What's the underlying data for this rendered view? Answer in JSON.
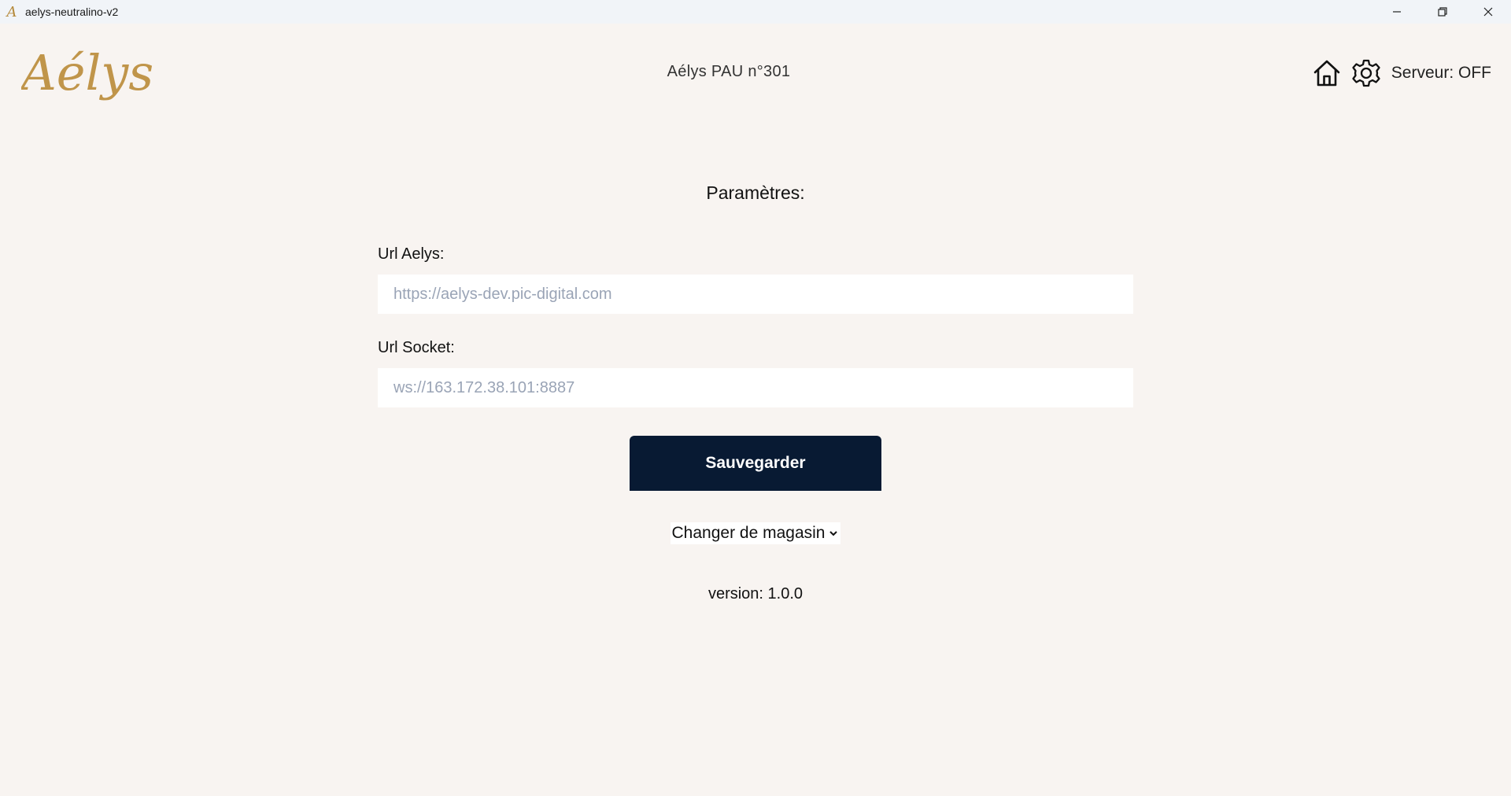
{
  "window": {
    "title": "aelys-neutralino-v2",
    "app_icon_glyph": "A",
    "controls": [
      "minimize-icon",
      "restore-icon",
      "close-icon"
    ]
  },
  "header": {
    "logo_text": "Aélys",
    "store_title": "Aélys PAU n°301",
    "icons": [
      "home-icon",
      "gear-icon"
    ],
    "server_status": "Serveur: OFF"
  },
  "settings": {
    "title": "Paramètres:",
    "url_aelys": {
      "label": "Url Aelys:",
      "placeholder": "https://aelys-dev.pic-digital.com",
      "value": ""
    },
    "url_socket": {
      "label": "Url Socket:",
      "placeholder": "ws://163.172.38.101:8887",
      "value": ""
    },
    "save_label": "Sauvegarder",
    "store_select": {
      "selected": "Changer de magasin"
    },
    "version": "version: 1.0.0"
  },
  "colors": {
    "background": "#f8f4f1",
    "titlebar": "#f1f4f8",
    "logo_gold": "#c0954a",
    "button_navy": "#081a33",
    "placeholder": "#9aa4b6"
  }
}
